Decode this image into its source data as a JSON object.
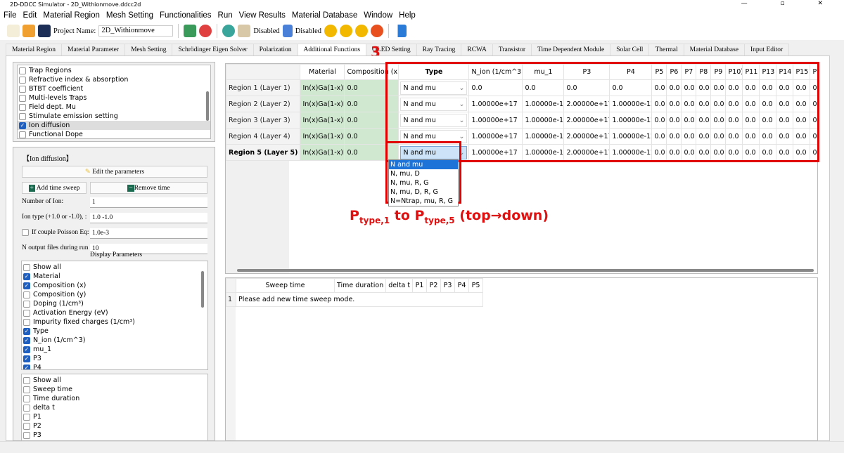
{
  "window": {
    "title": "2D-DDCC Simulator - 2D_Withionmove.ddcc2d",
    "controls": "— ▫ ✕"
  },
  "menu": [
    "File",
    "Edit",
    "Material Region",
    "Mesh Setting",
    "Functionalities",
    "Run",
    "View Results",
    "Material Database",
    "Window",
    "Help"
  ],
  "toolbar": {
    "project_label": "Project Name:",
    "project_name": "2D_Withionmove",
    "disabled_1": "Disabled",
    "disabled_2": "Disabled"
  },
  "tabs": [
    "Material Region",
    "Material Parameter",
    "Mesh Setting",
    "Schrödinger Eigen Solver",
    "Polarization",
    "Additional Functions",
    "OLED Setting",
    "Ray Tracing",
    "RCWA",
    "Transistor",
    "Time Dependent Module",
    "Solar Cell",
    "Thermal",
    "Material Database",
    "Input Editor"
  ],
  "active_tab": "Additional Functions",
  "functions": [
    {
      "label": "Trap Regions",
      "checked": false
    },
    {
      "label": "Refractive index & absorption",
      "checked": false
    },
    {
      "label": "BTBT coefficient",
      "checked": false
    },
    {
      "label": "Multi-levels Traps",
      "checked": false
    },
    {
      "label": "Field dept. Mu",
      "checked": false
    },
    {
      "label": "Stimulate emission setting",
      "checked": false
    },
    {
      "label": "Ion diffusion",
      "checked": true
    },
    {
      "label": "Functional Dope",
      "checked": false
    }
  ],
  "ion": {
    "group_title": "【Ion diffusion】",
    "edit_btn": "Edit the parameters",
    "add_btn": "Add time sweep",
    "remove_btn": "Remove time",
    "fields": [
      {
        "label": "Number of Ion:",
        "value": "1"
      },
      {
        "label": "Ion type (+1.0 or -1.0), :",
        "value": "1.0 -1.0"
      },
      {
        "label": "If couple Poisson Eq:",
        "value": "1.0e-3",
        "checkbox": true
      },
      {
        "label": "N output files during run",
        "value": "10"
      }
    ],
    "display_label": "Display Parameters"
  },
  "display_params": [
    {
      "label": "Show all",
      "checked": false
    },
    {
      "label": "Material",
      "checked": true
    },
    {
      "label": "Composition (x)",
      "checked": true
    },
    {
      "label": "Composition (y)",
      "checked": false
    },
    {
      "label": "Doping (1/cm³)",
      "checked": false
    },
    {
      "label": "Activation Energy (eV)",
      "checked": false
    },
    {
      "label": "Impurity fixed charges (1/cm³)",
      "checked": false
    },
    {
      "label": "Type",
      "checked": true
    },
    {
      "label": "N_ion (1/cm^3)",
      "checked": true
    },
    {
      "label": "mu_1",
      "checked": true
    },
    {
      "label": "P3",
      "checked": true
    },
    {
      "label": "P4",
      "checked": true
    }
  ],
  "sweep_params": [
    {
      "label": "Show all",
      "checked": false
    },
    {
      "label": "Sweep time",
      "checked": false
    },
    {
      "label": "Time duration",
      "checked": false
    },
    {
      "label": "delta t",
      "checked": false
    },
    {
      "label": "P1",
      "checked": false
    },
    {
      "label": "P2",
      "checked": false
    },
    {
      "label": "P3",
      "checked": false
    },
    {
      "label": "P4",
      "checked": true
    }
  ],
  "region_table": {
    "headers": [
      "Material",
      "Composition (x)",
      "Type",
      "N_ion (1/cm^3)",
      "mu_1",
      "P3",
      "P4",
      "P5",
      "P6",
      "P7",
      "P8",
      "P9",
      "P10)",
      "P11",
      "P13",
      "P14",
      "P15",
      "P16",
      "P"
    ],
    "rows": [
      {
        "name": "Region 1 (Layer 1)",
        "cells": [
          "In(x)Ga(1-x)N",
          "0.0",
          "N and mu",
          "0.0",
          "0.0",
          "0.0",
          "0.0",
          "0.0",
          "0.0",
          "0.0",
          "0.0",
          "0.0",
          "0.0",
          "0.0",
          "0.0",
          "0.0",
          "0.0",
          "0.0",
          "0."
        ]
      },
      {
        "name": "Region 2 (Layer 2)",
        "cells": [
          "In(x)Ga(1-x)N",
          "0.0",
          "N and mu",
          "1.00000e+17",
          "1.00000e-11",
          "2.00000e+17",
          "1.00000e-12",
          "0.0",
          "0.0",
          "0.0",
          "0.0",
          "0.0",
          "0.0",
          "0.0",
          "0.0",
          "0.0",
          "0.0",
          "0.0",
          "0."
        ]
      },
      {
        "name": "Region 3 (Layer 3)",
        "cells": [
          "In(x)Ga(1-x)N",
          "0.0",
          "N and mu",
          "1.00000e+17",
          "1.00000e-11",
          "2.00000e+17",
          "1.00000e-12",
          "0.0",
          "0.0",
          "0.0",
          "0.0",
          "0.0",
          "0.0",
          "0.0",
          "0.0",
          "0.0",
          "0.0",
          "0.0",
          "0."
        ]
      },
      {
        "name": "Region 4 (Layer 4)",
        "cells": [
          "In(x)Ga(1-x)N",
          "0.0",
          "N and mu",
          "1.00000e+17",
          "1.00000e-11",
          "2.00000e+17",
          "1.00000e-12",
          "0.0",
          "0.0",
          "0.0",
          "0.0",
          "0.0",
          "0.0",
          "0.0",
          "0.0",
          "0.0",
          "0.0",
          "0.0",
          "0."
        ]
      },
      {
        "name": "Region 5 (Layer 5)",
        "cells": [
          "In(x)Ga(1-x)N",
          "0.0",
          "N and mu",
          "1.00000e+17",
          "1.00000e-11",
          "2.00000e+17",
          "1.00000e-12",
          "0.0",
          "0.0",
          "0.0",
          "0.0",
          "0.0",
          "0.0",
          "0.0",
          "0.0",
          "0.0",
          "0.0",
          "0.0",
          "0."
        ]
      }
    ]
  },
  "type_options": [
    "N and mu",
    "N, mu, D",
    "N, mu, R, G",
    "N, mu, D, R, G",
    "N=Ntrap, mu, R, G"
  ],
  "type_selected": "N and mu",
  "sweep_table": {
    "headers": [
      "Sweep time",
      "Time duration",
      "delta t",
      "P1",
      "P2",
      "P3",
      "P4",
      "P5"
    ],
    "rows": [
      {
        "index": "1",
        "text": "Please add new time sweep mode."
      }
    ]
  },
  "annotation": {
    "number": "3",
    "p": "P",
    "sub1": "type,1",
    "mid": " to P",
    "sub2": "type,5",
    "tail": " (top→down)",
    "color": "#e01010"
  }
}
